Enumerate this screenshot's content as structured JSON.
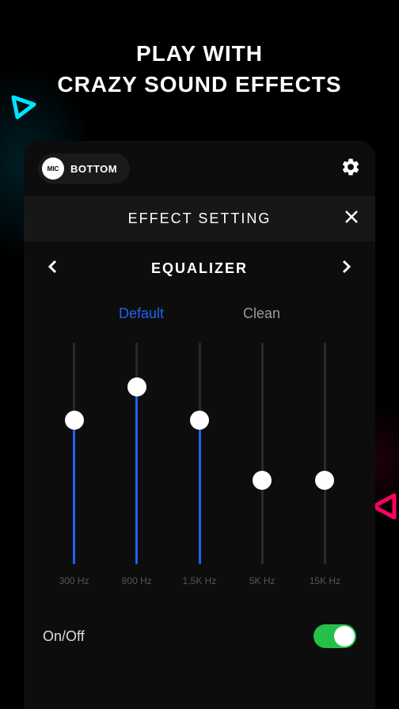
{
  "header": {
    "line1": "PLAY WITH",
    "line2": "CRAZY SOUND EFFECTS"
  },
  "topbar": {
    "mic_badge": "MIC",
    "mic_label": "BOTTOM"
  },
  "effect": {
    "title": "EFFECT SETTING",
    "equalizer_label": "EQUALIZER"
  },
  "presets": [
    {
      "label": "Default",
      "active": true
    },
    {
      "label": "Clean",
      "active": false
    }
  ],
  "sliders": [
    {
      "freq": "300 Hz",
      "value": 65
    },
    {
      "freq": "800 Hz",
      "value": 80
    },
    {
      "freq": "1,5K Hz",
      "value": 65
    },
    {
      "freq": "5K Hz",
      "value": 38
    },
    {
      "freq": "15K Hz",
      "value": 38
    }
  ],
  "onoff": {
    "label": "On/Off",
    "enabled": true
  }
}
